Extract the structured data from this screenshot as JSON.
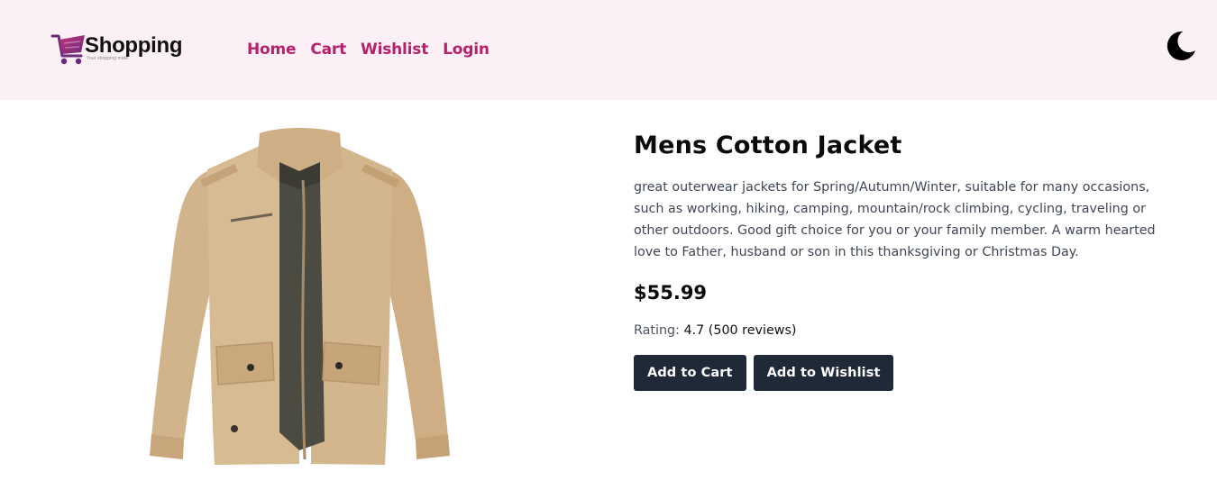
{
  "brand": {
    "name": "Shopping",
    "tagline": "Your shopping mate"
  },
  "nav": {
    "items": [
      {
        "label": "Home"
      },
      {
        "label": "Cart"
      },
      {
        "label": "Wishlist"
      },
      {
        "label": "Login"
      }
    ],
    "color": "#b8216a"
  },
  "theme_toggle": {
    "icon": "moon-icon"
  },
  "product": {
    "image_icon": "jacket-image",
    "title": "Mens Cotton Jacket",
    "description": "great outerwear jackets for Spring/Autumn/Winter, suitable for many occasions, such as working, hiking, camping, mountain/rock climbing, cycling, traveling or other outdoors. Good gift choice for you or your family member. A warm hearted love to Father, husband or son in this thanksgiving or Christmas Day.",
    "price": "$55.99",
    "rating_label": "Rating:",
    "rating_value": "4.7",
    "reviews": "(500 reviews)",
    "add_to_cart_label": "Add to Cart",
    "add_to_wishlist_label": "Add to Wishlist"
  },
  "colors": {
    "header_bg": "#fcf0f7",
    "button_bg": "#1f2937",
    "accent": "#b8216a"
  }
}
